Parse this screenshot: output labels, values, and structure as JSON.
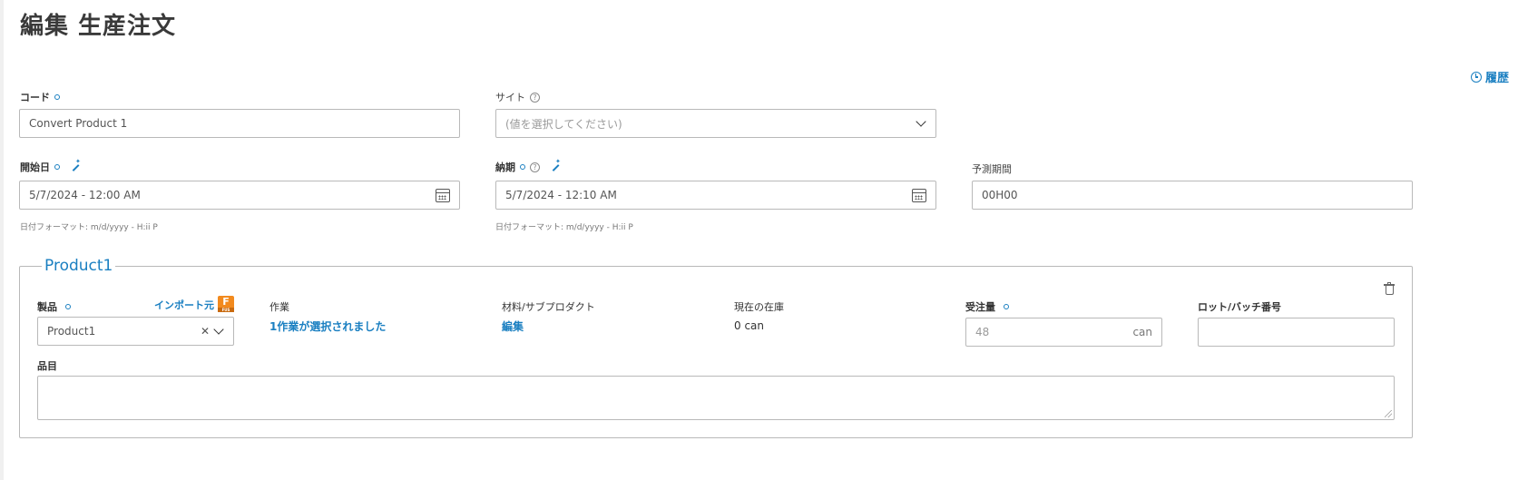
{
  "page": {
    "title": "編集 生産注文"
  },
  "history_link": {
    "label": "履歴",
    "icon": "clock-icon"
  },
  "fields": {
    "code": {
      "label": "コード",
      "value": "Convert Product 1"
    },
    "site": {
      "label": "サイト",
      "placeholder": "(値を選択してください)"
    },
    "start_date": {
      "label": "開始日",
      "value": "5/7/2024 - 12:00 AM",
      "hint": "日付フォーマット: m/d/yyyy - H:ii P"
    },
    "due_date": {
      "label": "納期",
      "value": "5/7/2024 - 12:10 AM",
      "hint": "日付フォーマット: m/d/yyyy - H:ii P"
    },
    "forecast_period": {
      "label": "予測期間",
      "value": "00H00"
    }
  },
  "product_section": {
    "legend": "Product1",
    "product": {
      "label": "製品",
      "value": "Product1",
      "import_label": "インポート元",
      "import_icon": "F"
    },
    "operations": {
      "label": "作業",
      "value": "1作業が選択されました"
    },
    "materials": {
      "label": "材料/サブプロダクト",
      "value": "編集"
    },
    "current_stock": {
      "label": "現在の在庫",
      "value": "0 can"
    },
    "order_qty": {
      "label": "受注量",
      "value": "48",
      "unit": "can"
    },
    "lot_batch": {
      "label": "ロット/バッチ番号",
      "value": ""
    },
    "item": {
      "label": "品目",
      "value": ""
    }
  },
  "colors": {
    "accent": "#1a7fc1",
    "fusion_orange": "#f28a1e"
  }
}
